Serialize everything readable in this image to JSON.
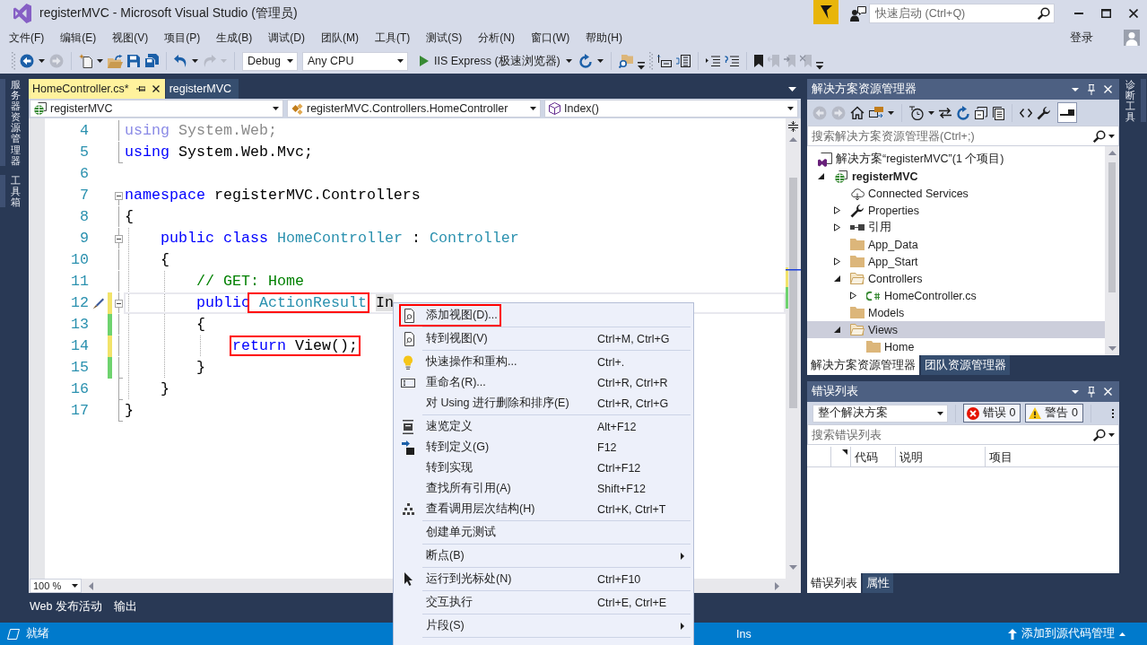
{
  "window": {
    "title": "registerMVC - Microsoft Visual Studio (管理员)",
    "quick_launch": {
      "placeholder": "快速启动 (Ctrl+Q)"
    },
    "sign_in": "登录"
  },
  "menu": [
    "文件(F)",
    "编辑(E)",
    "视图(V)",
    "项目(P)",
    "生成(B)",
    "调试(D)",
    "团队(M)",
    "工具(T)",
    "测试(S)",
    "分析(N)",
    "窗口(W)",
    "帮助(H)"
  ],
  "toolbar": {
    "configuration": "Debug",
    "platform": "Any CPU",
    "run_target": "IIS Express (极速浏览器)"
  },
  "left_strip": [
    "服务器资源管理器",
    "工具箱"
  ],
  "editor": {
    "tabs": [
      {
        "label": "HomeController.cs*",
        "selected": true
      },
      {
        "label": "registerMVC",
        "selected": false
      }
    ],
    "nav": [
      {
        "kind": "project",
        "label": "registerMVC"
      },
      {
        "kind": "class",
        "label": "registerMVC.Controllers.HomeController"
      },
      {
        "kind": "method",
        "label": "Index()"
      }
    ],
    "lines": [
      {
        "number": "4",
        "quick_actions": false,
        "changed_unsaved": false,
        "changed_saved": false,
        "collapsible": false,
        "outlined": true,
        "outline_end": false,
        "current": false,
        "tokens": [
          {
            "kind": "faded-keyword",
            "text": "using"
          },
          {
            "kind": "faded",
            "text": " System.Web;"
          }
        ]
      },
      {
        "number": "5",
        "quick_actions": false,
        "changed_unsaved": false,
        "changed_saved": false,
        "collapsible": false,
        "outlined": true,
        "outline_end": true,
        "current": false,
        "tokens": [
          {
            "kind": "keyword",
            "text": "using"
          },
          {
            "kind": "plain",
            "text": " System.Web.Mvc;"
          }
        ]
      },
      {
        "number": "6",
        "quick_actions": false,
        "changed_unsaved": false,
        "changed_saved": false,
        "collapsible": false,
        "outlined": false,
        "outline_end": false,
        "current": false
      },
      {
        "number": "7",
        "quick_actions": false,
        "changed_unsaved": false,
        "changed_saved": false,
        "collapsible": true,
        "outlined": false,
        "outline_end": false,
        "current": false,
        "tokens": [
          {
            "kind": "keyword",
            "text": "namespace"
          },
          {
            "kind": "plain",
            "text": " registerMVC.Controllers"
          }
        ]
      },
      {
        "number": "8",
        "quick_actions": false,
        "changed_unsaved": false,
        "changed_saved": false,
        "collapsible": false,
        "outlined": true,
        "outline_end": false,
        "current": false,
        "tokens": [
          {
            "kind": "plain",
            "text": "{"
          }
        ]
      },
      {
        "number": "9",
        "quick_actions": false,
        "changed_unsaved": false,
        "changed_saved": false,
        "collapsible": true,
        "outlined": true,
        "outline_end": false,
        "current": false,
        "tokens": [
          {
            "kind": "keyword",
            "text": "    public"
          },
          {
            "kind": "keyword",
            "text": " class"
          },
          {
            "kind": "type",
            "text": " HomeController"
          },
          {
            "kind": "plain",
            "text": " : "
          },
          {
            "kind": "type",
            "text": "Controller"
          }
        ]
      },
      {
        "number": "10",
        "quick_actions": false,
        "changed_unsaved": false,
        "changed_saved": false,
        "collapsible": false,
        "outlined": true,
        "outline_end": false,
        "current": false,
        "tokens": [
          {
            "kind": "plain",
            "text": "    {"
          }
        ]
      },
      {
        "number": "11",
        "quick_actions": false,
        "changed_unsaved": false,
        "changed_saved": false,
        "collapsible": false,
        "outlined": true,
        "outline_end": false,
        "current": false,
        "tokens": [
          {
            "kind": "comment",
            "text": "        // GET: Home"
          }
        ]
      },
      {
        "number": "12",
        "quick_actions": true,
        "changed_unsaved": true,
        "changed_saved": false,
        "collapsible": true,
        "outlined": true,
        "outline_end": false,
        "current": true,
        "tokens": [
          {
            "kind": "keyword",
            "text": "        public"
          },
          {
            "kind": "annotation",
            "tokens": [
              {
                "kind": "type",
                "text": " ActionResult"
              }
            ]
          },
          {
            "kind": "highlighted",
            "text": " In"
          }
        ]
      },
      {
        "number": "13",
        "quick_actions": false,
        "changed_unsaved": false,
        "changed_saved": true,
        "collapsible": false,
        "outlined": true,
        "outline_end": false,
        "current": false,
        "tokens": [
          {
            "kind": "plain",
            "text": "        {"
          }
        ]
      },
      {
        "number": "14",
        "quick_actions": false,
        "changed_unsaved": true,
        "changed_saved": false,
        "collapsible": false,
        "outlined": true,
        "outline_end": false,
        "current": false,
        "tokens": [
          {
            "kind": "annotation",
            "tokens": [
              {
                "kind": "keyword",
                "text": "            return"
              },
              {
                "kind": "plain",
                "text": " View();"
              }
            ]
          }
        ]
      },
      {
        "number": "15",
        "quick_actions": false,
        "changed_unsaved": false,
        "changed_saved": true,
        "collapsible": false,
        "outlined": true,
        "outline_end": true,
        "current": false,
        "tokens": [
          {
            "kind": "plain",
            "text": "        }"
          }
        ]
      },
      {
        "number": "16",
        "quick_actions": false,
        "changed_unsaved": false,
        "changed_saved": false,
        "collapsible": false,
        "outlined": true,
        "outline_end": true,
        "current": false,
        "tokens": [
          {
            "kind": "plain",
            "text": "    }"
          }
        ]
      },
      {
        "number": "17",
        "quick_actions": false,
        "changed_unsaved": false,
        "changed_saved": false,
        "collapsible": false,
        "outlined": true,
        "outline_end": true,
        "current": false,
        "tokens": [
          {
            "kind": "plain",
            "text": "}"
          }
        ]
      }
    ],
    "zoom": "100 %"
  },
  "bottom_tabs": [
    "Web 发布活动",
    "输出"
  ],
  "solution_explorer": {
    "title": "解决方案资源管理器",
    "preview_toggle": {
      "selected": true
    },
    "search": {
      "placeholder": "搜索解决方案资源管理器(Ctrl+;)"
    },
    "tree": [
      {
        "kind": "solution",
        "label": "解决方案“registerMVC”(1 个项目)",
        "selected": false,
        "children": [
          {
            "kind": "startup-project",
            "label": "registerMVC",
            "expanded": true,
            "selected": false,
            "children": [
              {
                "kind": "connected-services",
                "label": "Connected Services",
                "selected": false
              },
              {
                "kind": "properties",
                "label": "Properties",
                "expanded": false,
                "selected": false
              },
              {
                "kind": "references",
                "label": "引用",
                "expanded": false,
                "selected": false
              },
              {
                "kind": "folder",
                "label": "App_Data",
                "selected": false
              },
              {
                "kind": "folder",
                "label": "App_Start",
                "expanded": false,
                "selected": false
              },
              {
                "kind": "folder",
                "label": "Controllers",
                "expanded": true,
                "selected": false,
                "children": [
                  {
                    "kind": "csharp-file",
                    "label": "HomeController.cs",
                    "expanded": false,
                    "selected": false
                  }
                ]
              },
              {
                "kind": "folder",
                "label": "Models",
                "selected": false
              },
              {
                "kind": "folder",
                "label": "Views",
                "expanded": true,
                "selected": true,
                "children": [
                  {
                    "kind": "folder",
                    "label": "Home",
                    "selected": false
                  }
                ]
              }
            ]
          }
        ]
      }
    ],
    "tabs": [
      {
        "label": "解决方案资源管理器",
        "selected": true
      },
      {
        "label": "团队资源管理器",
        "selected": false
      }
    ]
  },
  "error_list": {
    "title": "错误列表",
    "scope": "整个解决方案",
    "filters": [
      {
        "kind": "errors",
        "label": "错误 0",
        "selected": true
      },
      {
        "kind": "warnings",
        "label": "警告 0",
        "selected": true
      }
    ],
    "search": {
      "placeholder": "搜索错误列表"
    },
    "columns": [
      "代码",
      "说明",
      "项目"
    ],
    "tabs": [
      {
        "label": "错误列表",
        "selected": true
      },
      {
        "label": "属性",
        "selected": false
      }
    ]
  },
  "right_strip": [
    "诊断工具"
  ],
  "status_bar": {
    "message": "就绪",
    "mode": "Ins",
    "source_control": "添加到源代码管理"
  },
  "context_menu": {
    "items": [
      {
        "kind": "add-view",
        "label": "添加视图(D)...",
        "annotated": true
      },
      {
        "kind": "separator"
      },
      {
        "kind": "go-to-view",
        "label": "转到视图(V)",
        "shortcut": "Ctrl+M, Ctrl+G",
        "annotated": false
      },
      {
        "kind": "separator"
      },
      {
        "kind": "quick-actions",
        "label": "快速操作和重构...",
        "shortcut": "Ctrl+.",
        "annotated": false
      },
      {
        "kind": "rename",
        "label": "重命名(R)...",
        "shortcut": "Ctrl+R, Ctrl+R",
        "annotated": false
      },
      {
        "kind": "plain",
        "label": "对 Using 进行删除和排序(E)",
        "shortcut": "Ctrl+R, Ctrl+G",
        "annotated": false
      },
      {
        "kind": "separator"
      },
      {
        "kind": "peek",
        "label": "速览定义",
        "shortcut": "Alt+F12",
        "annotated": false
      },
      {
        "kind": "go-to-definition",
        "label": "转到定义(G)",
        "shortcut": "F12",
        "annotated": false
      },
      {
        "kind": "plain",
        "label": "转到实现",
        "shortcut": "Ctrl+F12",
        "annotated": false
      },
      {
        "kind": "plain",
        "label": "查找所有引用(A)",
        "shortcut": "Shift+F12",
        "annotated": false
      },
      {
        "kind": "call-hierarchy",
        "label": "查看调用层次结构(H)",
        "shortcut": "Ctrl+K, Ctrl+T",
        "annotated": false
      },
      {
        "kind": "separator"
      },
      {
        "kind": "plain",
        "label": "创建单元测试",
        "annotated": false
      },
      {
        "kind": "separator"
      },
      {
        "kind": "submenu",
        "label": "断点(B)",
        "annotated": false
      },
      {
        "kind": "separator"
      },
      {
        "kind": "run-to-cursor",
        "label": "运行到光标处(N)",
        "shortcut": "Ctrl+F10",
        "annotated": false
      },
      {
        "kind": "separator"
      },
      {
        "kind": "plain",
        "label": "交互执行",
        "shortcut": "Ctrl+E, Ctrl+E",
        "annotated": false
      },
      {
        "kind": "separator"
      },
      {
        "kind": "submenu",
        "label": "片段(S)",
        "annotated": false
      },
      {
        "kind": "separator"
      }
    ]
  }
}
